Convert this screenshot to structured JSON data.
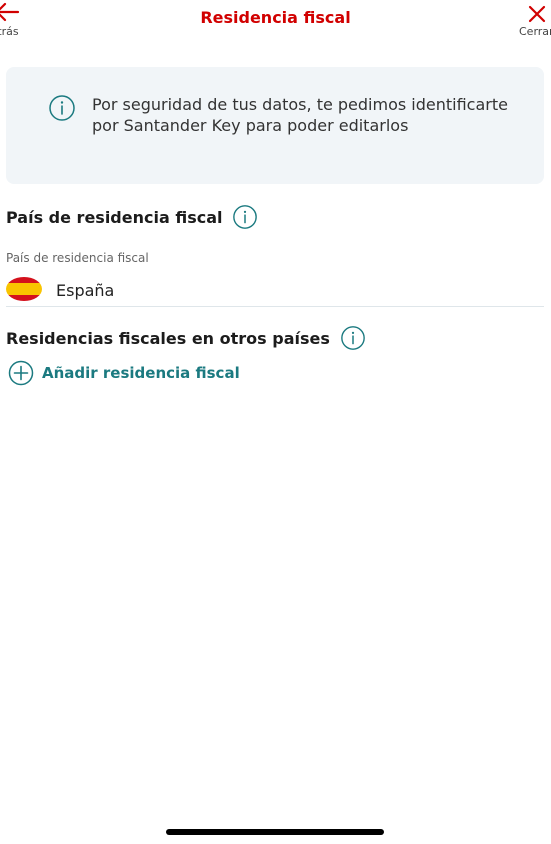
{
  "header": {
    "back_label": "Atrás",
    "close_label": "Cerrar",
    "title": "Residencia fiscal"
  },
  "banner": {
    "text": "Por seguridad de tus datos, te pedimos identificarte por Santander Key para poder editarlos"
  },
  "fiscal_residence": {
    "heading": "País de residencia fiscal",
    "field_label": "País de residencia fiscal",
    "value": "España"
  },
  "other_residences": {
    "heading": "Residencias fiscales en otros países",
    "add_label": "Añadir residencia fiscal"
  },
  "colors": {
    "brand": "#d10000",
    "accent": "#1b7a80",
    "banner_bg": "#f1f5f8"
  },
  "icons": {
    "back": "arrow-left-icon",
    "close": "close-icon",
    "info": "info-icon",
    "add": "plus-circle-icon",
    "flag": "spain-flag-icon"
  }
}
